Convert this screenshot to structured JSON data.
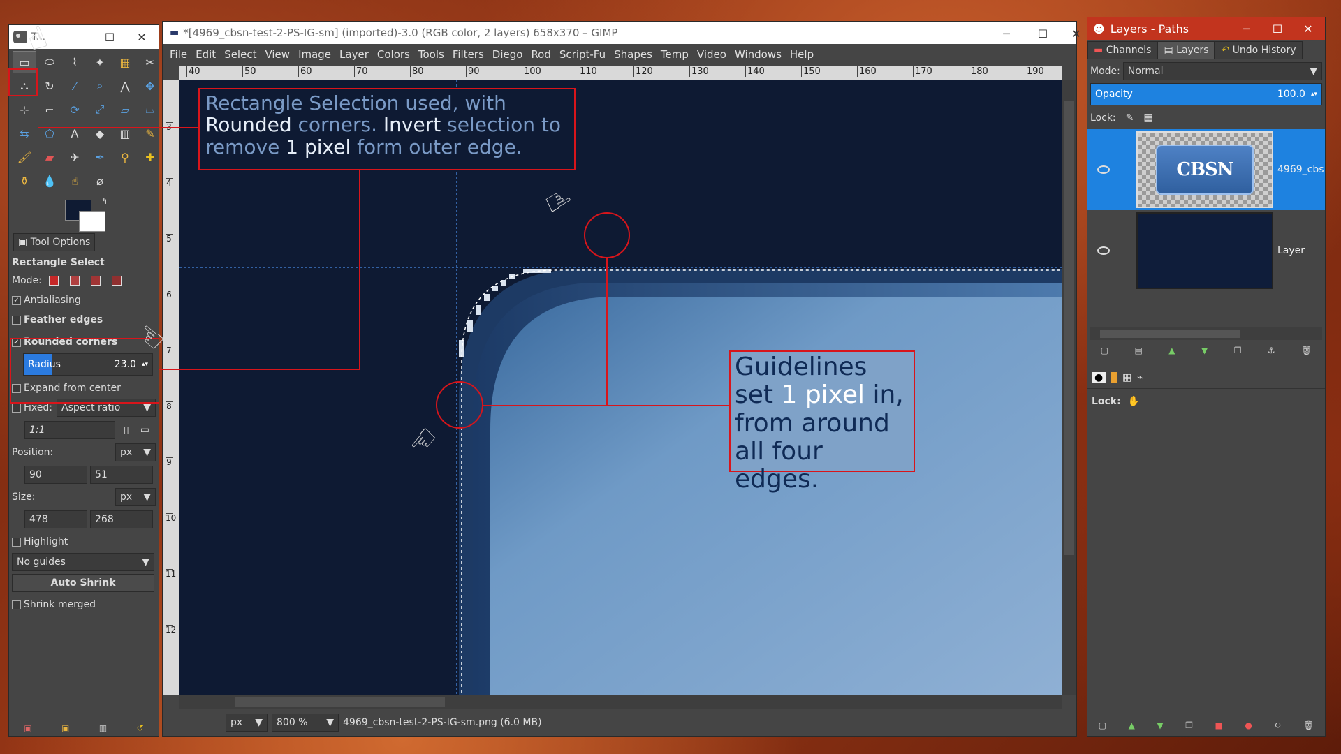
{
  "toolbox": {
    "title": "T...",
    "dock_tab": "Tool Options",
    "tool_name": "Rectangle Select",
    "mode_label": "Mode:",
    "antialiasing": "Antialiasing",
    "feather_edges": "Feather edges",
    "rounded_corners": "Rounded corners",
    "radius_label": "Radius",
    "radius_value": "23.0",
    "expand_from_center": "Expand from center",
    "fixed_label": "Fixed:",
    "fixed_value": "Aspect ratio",
    "ratio_value": "1:1",
    "position_label": "Position:",
    "position_unit": "px",
    "pos_x": "90",
    "pos_y": "51",
    "size_label": "Size:",
    "size_unit": "px",
    "size_w": "478",
    "size_h": "268",
    "highlight": "Highlight",
    "guides_value": "No guides",
    "auto_shrink": "Auto Shrink",
    "shrink_merged": "Shrink merged"
  },
  "imagewin": {
    "title": "*[4969_cbsn-test-2-PS-IG-sm] (imported)-3.0 (RGB color, 2 layers) 658x370 – GIMP",
    "menus": [
      "File",
      "Edit",
      "Select",
      "View",
      "Image",
      "Layer",
      "Colors",
      "Tools",
      "Filters",
      "Diego",
      "Rod",
      "Script-Fu",
      "Shapes",
      "Temp",
      "Video",
      "Windows",
      "Help"
    ],
    "ruler_h": [
      "40",
      "50",
      "60",
      "70",
      "80",
      "90",
      "100",
      "110",
      "120",
      "130",
      "140",
      "150",
      "160",
      "170",
      "180",
      "190"
    ],
    "ruler_v": [
      "3",
      "4",
      "5",
      "6",
      "7",
      "8",
      "9",
      "10",
      "11",
      "12"
    ],
    "status_unit": "px",
    "zoom": "800 %",
    "status_file": "4969_cbsn-test-2-PS-IG-sm.png (6.0 MB)"
  },
  "annotations": {
    "box1_line1_a": "Rectangle Selection used, with",
    "box1_line2_b": "Rounded",
    "box1_line2_c": " corners. ",
    "box1_line2_d": "Invert",
    "box1_line2_e": " selection to",
    "box1_line3_a": "remove ",
    "box1_line3_b": "1 pixel",
    "box1_line3_c": " form outer edge.",
    "box2_line1": "Guidelines",
    "box2_line2_a": "set ",
    "box2_line2_b": "1 pixel",
    "box2_line2_c": " in,",
    "box2_line3": "from around",
    "box2_line4": "all four edges."
  },
  "layers": {
    "title": "Layers - Paths",
    "tabs": [
      "Channels",
      "Layers",
      "Undo History"
    ],
    "mode_label": "Mode:",
    "mode_value": "Normal",
    "opacity_label": "Opacity",
    "opacity_value": "100.0",
    "lock_label": "Lock:",
    "layer1_name": "4969_cbs",
    "layer1_logo": "CBSN",
    "layer2_name": "Layer",
    "lock_label2": "Lock:"
  },
  "colors": {
    "accent": "#1e82e0",
    "annotation_red": "#d8151b",
    "canvas_bg": "#0e1a33"
  }
}
